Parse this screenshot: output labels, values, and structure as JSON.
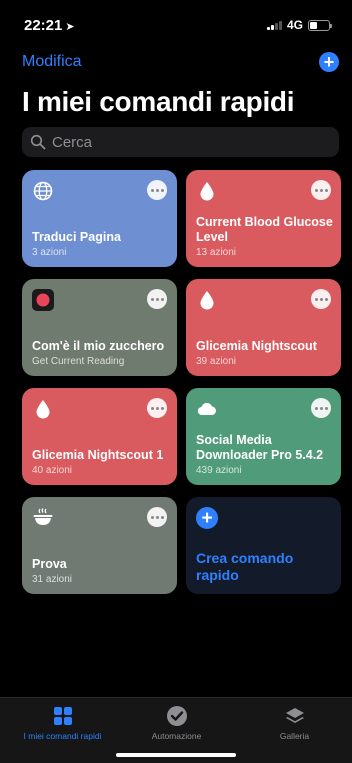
{
  "status": {
    "time": "22:21",
    "network": "4G"
  },
  "header": {
    "edit_label": "Modifica",
    "add_symbol": "+",
    "title": "I miei comandi rapidi"
  },
  "search": {
    "placeholder": "Cerca"
  },
  "shortcuts": [
    {
      "name": "Traduci Pagina",
      "sub": "3 azioni",
      "color": "#6e8fd2",
      "icon": "globe-icon"
    },
    {
      "name": "Current Blood Glucose Level",
      "sub": "13 azioni",
      "color": "#d95b5f",
      "icon": "drop-icon"
    },
    {
      "name": "Com'è il mio zucchero",
      "sub": "Get Current Reading",
      "color": "#6f7b6f",
      "icon": "app-icon"
    },
    {
      "name": "Glicemia Nightscout",
      "sub": "39 azioni",
      "color": "#d95b5f",
      "icon": "drop-icon"
    },
    {
      "name": "Glicemia Nightscout 1",
      "sub": "40 azioni",
      "color": "#d95b5f",
      "icon": "drop-icon"
    },
    {
      "name": "Social Media Downloader Pro 5.4.2",
      "sub": "439 azioni",
      "color": "#4f9b7a",
      "icon": "cloud-icon"
    },
    {
      "name": "Prova",
      "sub": "31 azioni",
      "color": "#707a73",
      "icon": "bowl-icon"
    }
  ],
  "create": {
    "label": "Crea comando rapido",
    "plus": "+"
  },
  "tabs": [
    {
      "label": "I miei comandi rapidi",
      "active": true
    },
    {
      "label": "Automazione",
      "active": false
    },
    {
      "label": "Galleria",
      "active": false
    }
  ],
  "accent": "#2f80ff"
}
